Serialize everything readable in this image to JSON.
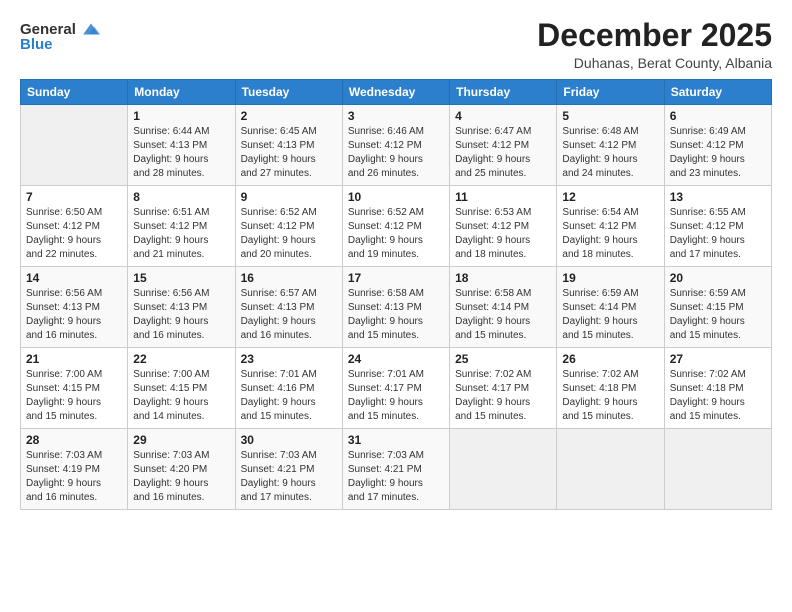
{
  "header": {
    "logo_general": "General",
    "logo_blue": "Blue",
    "month_title": "December 2025",
    "subtitle": "Duhanas, Berat County, Albania"
  },
  "weekdays": [
    "Sunday",
    "Monday",
    "Tuesday",
    "Wednesday",
    "Thursday",
    "Friday",
    "Saturday"
  ],
  "weeks": [
    [
      {
        "day": "",
        "info": ""
      },
      {
        "day": "1",
        "info": "Sunrise: 6:44 AM\nSunset: 4:13 PM\nDaylight: 9 hours\nand 28 minutes."
      },
      {
        "day": "2",
        "info": "Sunrise: 6:45 AM\nSunset: 4:13 PM\nDaylight: 9 hours\nand 27 minutes."
      },
      {
        "day": "3",
        "info": "Sunrise: 6:46 AM\nSunset: 4:12 PM\nDaylight: 9 hours\nand 26 minutes."
      },
      {
        "day": "4",
        "info": "Sunrise: 6:47 AM\nSunset: 4:12 PM\nDaylight: 9 hours\nand 25 minutes."
      },
      {
        "day": "5",
        "info": "Sunrise: 6:48 AM\nSunset: 4:12 PM\nDaylight: 9 hours\nand 24 minutes."
      },
      {
        "day": "6",
        "info": "Sunrise: 6:49 AM\nSunset: 4:12 PM\nDaylight: 9 hours\nand 23 minutes."
      }
    ],
    [
      {
        "day": "7",
        "info": "Sunrise: 6:50 AM\nSunset: 4:12 PM\nDaylight: 9 hours\nand 22 minutes."
      },
      {
        "day": "8",
        "info": "Sunrise: 6:51 AM\nSunset: 4:12 PM\nDaylight: 9 hours\nand 21 minutes."
      },
      {
        "day": "9",
        "info": "Sunrise: 6:52 AM\nSunset: 4:12 PM\nDaylight: 9 hours\nand 20 minutes."
      },
      {
        "day": "10",
        "info": "Sunrise: 6:52 AM\nSunset: 4:12 PM\nDaylight: 9 hours\nand 19 minutes."
      },
      {
        "day": "11",
        "info": "Sunrise: 6:53 AM\nSunset: 4:12 PM\nDaylight: 9 hours\nand 18 minutes."
      },
      {
        "day": "12",
        "info": "Sunrise: 6:54 AM\nSunset: 4:12 PM\nDaylight: 9 hours\nand 18 minutes."
      },
      {
        "day": "13",
        "info": "Sunrise: 6:55 AM\nSunset: 4:12 PM\nDaylight: 9 hours\nand 17 minutes."
      }
    ],
    [
      {
        "day": "14",
        "info": "Sunrise: 6:56 AM\nSunset: 4:13 PM\nDaylight: 9 hours\nand 16 minutes."
      },
      {
        "day": "15",
        "info": "Sunrise: 6:56 AM\nSunset: 4:13 PM\nDaylight: 9 hours\nand 16 minutes."
      },
      {
        "day": "16",
        "info": "Sunrise: 6:57 AM\nSunset: 4:13 PM\nDaylight: 9 hours\nand 16 minutes."
      },
      {
        "day": "17",
        "info": "Sunrise: 6:58 AM\nSunset: 4:13 PM\nDaylight: 9 hours\nand 15 minutes."
      },
      {
        "day": "18",
        "info": "Sunrise: 6:58 AM\nSunset: 4:14 PM\nDaylight: 9 hours\nand 15 minutes."
      },
      {
        "day": "19",
        "info": "Sunrise: 6:59 AM\nSunset: 4:14 PM\nDaylight: 9 hours\nand 15 minutes."
      },
      {
        "day": "20",
        "info": "Sunrise: 6:59 AM\nSunset: 4:15 PM\nDaylight: 9 hours\nand 15 minutes."
      }
    ],
    [
      {
        "day": "21",
        "info": "Sunrise: 7:00 AM\nSunset: 4:15 PM\nDaylight: 9 hours\nand 15 minutes."
      },
      {
        "day": "22",
        "info": "Sunrise: 7:00 AM\nSunset: 4:15 PM\nDaylight: 9 hours\nand 14 minutes."
      },
      {
        "day": "23",
        "info": "Sunrise: 7:01 AM\nSunset: 4:16 PM\nDaylight: 9 hours\nand 15 minutes."
      },
      {
        "day": "24",
        "info": "Sunrise: 7:01 AM\nSunset: 4:17 PM\nDaylight: 9 hours\nand 15 minutes."
      },
      {
        "day": "25",
        "info": "Sunrise: 7:02 AM\nSunset: 4:17 PM\nDaylight: 9 hours\nand 15 minutes."
      },
      {
        "day": "26",
        "info": "Sunrise: 7:02 AM\nSunset: 4:18 PM\nDaylight: 9 hours\nand 15 minutes."
      },
      {
        "day": "27",
        "info": "Sunrise: 7:02 AM\nSunset: 4:18 PM\nDaylight: 9 hours\nand 15 minutes."
      }
    ],
    [
      {
        "day": "28",
        "info": "Sunrise: 7:03 AM\nSunset: 4:19 PM\nDaylight: 9 hours\nand 16 minutes."
      },
      {
        "day": "29",
        "info": "Sunrise: 7:03 AM\nSunset: 4:20 PM\nDaylight: 9 hours\nand 16 minutes."
      },
      {
        "day": "30",
        "info": "Sunrise: 7:03 AM\nSunset: 4:21 PM\nDaylight: 9 hours\nand 17 minutes."
      },
      {
        "day": "31",
        "info": "Sunrise: 7:03 AM\nSunset: 4:21 PM\nDaylight: 9 hours\nand 17 minutes."
      },
      {
        "day": "",
        "info": ""
      },
      {
        "day": "",
        "info": ""
      },
      {
        "day": "",
        "info": ""
      }
    ]
  ]
}
